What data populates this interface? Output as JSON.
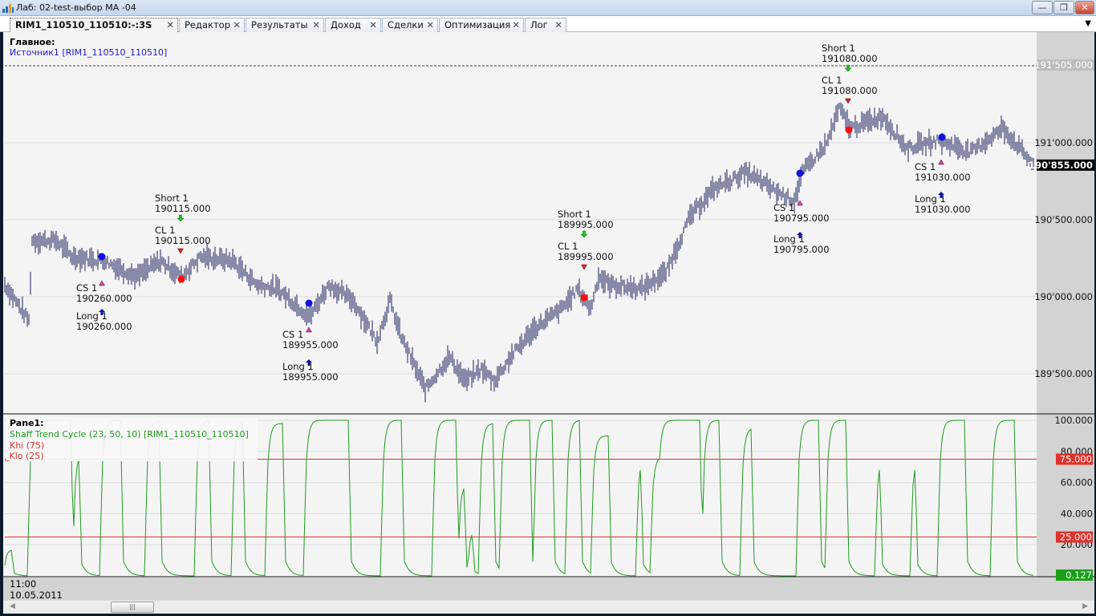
{
  "window": {
    "title": "Лаб: 02-test-выбор МА -04",
    "min": "—",
    "restore": "❐",
    "close": "✕"
  },
  "tabs": [
    {
      "label": "RIM1_110510_110510:-:3S",
      "active": true
    },
    {
      "label": "Редактор"
    },
    {
      "label": "Результаты"
    },
    {
      "label": "Доход"
    },
    {
      "label": "Сделки"
    },
    {
      "label": "Оптимизация"
    },
    {
      "label": "Лог"
    }
  ],
  "tab_close": "✕",
  "main_pane": {
    "title": "Главное:",
    "source": "Источник1 [RIM1_110510_110510]",
    "axis_labels": [
      "191'505.000",
      "191'000.000",
      "190'500.000",
      "190'000.000",
      "189'500.000"
    ],
    "last_price": "190'855.000",
    "level_line": "191'505.000"
  },
  "lower_pane": {
    "title": "Pane1:",
    "indicator": "Shaff Trend Cycle (23, 50, 10) [RIM1_110510_110510]",
    "khi": "Khi (75)",
    "klo": "_Klo (25)",
    "axis_labels": [
      "100.000",
      "80.000",
      "60.000",
      "40.000",
      "20.000"
    ],
    "khi_value": "75.000",
    "klo_value": "25.000",
    "last_value": "0.127"
  },
  "time_axis": {
    "time": "11:00",
    "date": "10.05.2011"
  },
  "colors": {
    "bars": "#1a1f5c",
    "stc": "#1f9a1f",
    "levels": "#e0302a",
    "long": "#1010e0",
    "exit": "#ff1010"
  },
  "trades": [
    {
      "label1": "CS 1",
      "price1": "190260.000",
      "label2": "Long 1",
      "price2": "190260.000",
      "kind": "long"
    },
    {
      "label1": "Short 1",
      "price1": "190115.000",
      "label2": "CL 1",
      "price2": "190115.000",
      "kind": "short"
    },
    {
      "label1": "CS 1",
      "price1": "189955.000",
      "label2": "Long 1",
      "price2": "189955.000",
      "kind": "long"
    },
    {
      "label1": "Short 1",
      "price1": "189995.000",
      "label2": "CL 1",
      "price2": "189995.000",
      "kind": "short"
    },
    {
      "label1": "CS 1",
      "price1": "190795.000",
      "label2": "Long 1",
      "price2": "190795.000",
      "kind": "long"
    },
    {
      "label1": "Short 1",
      "price1": "191080.000",
      "label2": "CL 1",
      "price2": "191080.000",
      "kind": "short"
    },
    {
      "label1": "CS 1",
      "price1": "191030.000",
      "label2": "Long 1",
      "price2": "191030.000",
      "kind": "long"
    }
  ],
  "chart_data": {
    "type": "line",
    "price_path": [
      [
        0,
        190078
      ],
      [
        15,
        189844
      ],
      [
        17,
        190365
      ],
      [
        32,
        190365
      ],
      [
        42,
        190260
      ],
      [
        62,
        190234
      ],
      [
        82,
        190130
      ],
      [
        97,
        190234
      ],
      [
        110,
        190130
      ],
      [
        122,
        190260
      ],
      [
        142,
        190234
      ],
      [
        157,
        190078
      ],
      [
        170,
        190052
      ],
      [
        190,
        189870
      ],
      [
        202,
        190078
      ],
      [
        217,
        189974
      ],
      [
        232,
        189714
      ],
      [
        240,
        189974
      ],
      [
        247,
        189740
      ],
      [
        262,
        189401
      ],
      [
        277,
        189609
      ],
      [
        287,
        189453
      ],
      [
        297,
        189531
      ],
      [
        305,
        189453
      ],
      [
        317,
        189635
      ],
      [
        330,
        189792
      ],
      [
        347,
        189922
      ],
      [
        357,
        190052
      ],
      [
        365,
        189922
      ],
      [
        370,
        190130
      ],
      [
        377,
        190078
      ],
      [
        397,
        190052
      ],
      [
        412,
        190156
      ],
      [
        427,
        190521
      ],
      [
        442,
        190703
      ],
      [
        462,
        190807
      ],
      [
        482,
        190677
      ],
      [
        492,
        190625
      ],
      [
        497,
        190807
      ],
      [
        512,
        190990
      ],
      [
        520,
        191224
      ],
      [
        527,
        191094
      ],
      [
        547,
        191172
      ],
      [
        562,
        190964
      ],
      [
        582,
        191016
      ],
      [
        602,
        190938
      ],
      [
        622,
        191094
      ],
      [
        641,
        190859
      ]
    ],
    "stc_pulses": [
      [
        1,
        4,
        17
      ],
      [
        16,
        41,
        100
      ],
      [
        44,
        46,
        80
      ],
      [
        61,
        72,
        100
      ],
      [
        89,
        96,
        100
      ],
      [
        120,
        127,
        100
      ],
      [
        143,
        148,
        100
      ],
      [
        164,
        173,
        98
      ],
      [
        188,
        214,
        100
      ],
      [
        236,
        247,
        100
      ],
      [
        268,
        281,
        100
      ],
      [
        284,
        286,
        60
      ],
      [
        290,
        291,
        30
      ],
      [
        297,
        304,
        98
      ],
      [
        310,
        327,
        100
      ],
      [
        331,
        341,
        100
      ],
      [
        351,
        358,
        100
      ],
      [
        367,
        376,
        90
      ],
      [
        395,
        396,
        78
      ],
      [
        404,
        407,
        77
      ],
      [
        408,
        433,
        100
      ],
      [
        436,
        445,
        100
      ],
      [
        460,
        465,
        95
      ],
      [
        495,
        507,
        100
      ],
      [
        513,
        524,
        100
      ],
      [
        544,
        545,
        78
      ],
      [
        566,
        567,
        78
      ],
      [
        583,
        598,
        100
      ],
      [
        616,
        629,
        100
      ]
    ],
    "price_ylim": [
      189250,
      191700
    ],
    "stc_ylim": [
      0,
      100
    ],
    "khi": 75,
    "klo": 25,
    "bars": 642
  }
}
